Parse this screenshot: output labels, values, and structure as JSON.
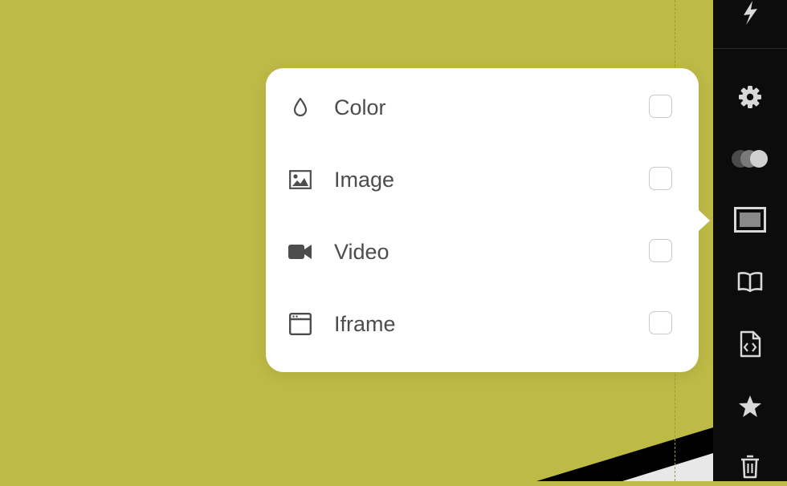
{
  "colors": {
    "canvas_background": "#bdba46",
    "sidebar_background": "#0c0c0c",
    "popover_background": "#ffffff",
    "text": "#4d4d4d"
  },
  "popover": {
    "options": [
      {
        "label": "Color",
        "icon": "droplet-icon",
        "checked": false
      },
      {
        "label": "Image",
        "icon": "image-icon",
        "checked": false
      },
      {
        "label": "Video",
        "icon": "video-camera-icon",
        "checked": false
      },
      {
        "label": "Iframe",
        "icon": "browser-window-icon",
        "checked": false
      }
    ]
  },
  "sidebar": {
    "items": [
      {
        "icon": "lightning-icon"
      },
      {
        "icon": "gear-icon"
      },
      {
        "icon": "toggle-circles-icon"
      },
      {
        "icon": "background-frame-icon",
        "active": true
      },
      {
        "icon": "book-icon"
      },
      {
        "icon": "code-file-icon"
      },
      {
        "icon": "star-icon"
      },
      {
        "icon": "trash-icon"
      }
    ]
  }
}
